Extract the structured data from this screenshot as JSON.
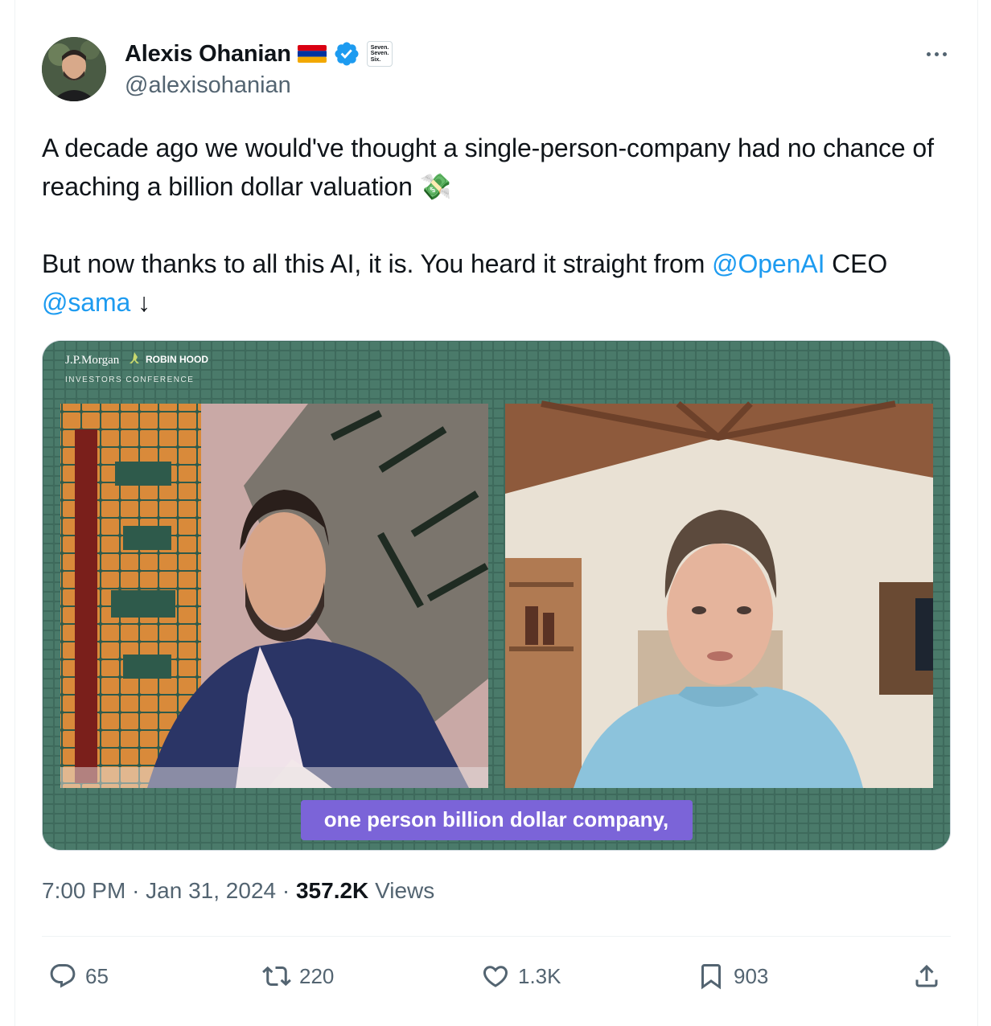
{
  "author": {
    "display_name": "Alexis Ohanian",
    "handle": "@alexisohanian",
    "flag_icon": "armenia-flag-icon",
    "verified_icon": "verified-badge-icon",
    "affiliate_badge_text": [
      "Seven.",
      "Seven.",
      "Six."
    ]
  },
  "tweet": {
    "line1": "A decade ago we would've thought a single-person-company had no chance of reaching a billion dollar valuation",
    "emoji": "💸",
    "line2_prefix": "But now thanks to all this AI, it is. You heard it straight from",
    "mention1": "@OpenAI",
    "line2_mid": "CEO",
    "mention2": "@sama",
    "arrow": "↓"
  },
  "media": {
    "brand_left": "J.P.Morgan",
    "brand_right": "ROBIN HOOD",
    "brand_sub": "INVESTORS CONFERENCE",
    "caption": "one person billion dollar company,"
  },
  "meta": {
    "time": "7:00 PM",
    "sep": "·",
    "date": "Jan 31, 2024",
    "views_count": "357.2K",
    "views_label": "Views"
  },
  "actions": {
    "reply": "65",
    "retweet": "220",
    "like": "1.3K",
    "bookmark": "903"
  },
  "colors": {
    "link": "#1d9bf0",
    "secondary_text": "#536471",
    "caption_bg": "#7b64d8",
    "media_bg": "#3b6155"
  }
}
